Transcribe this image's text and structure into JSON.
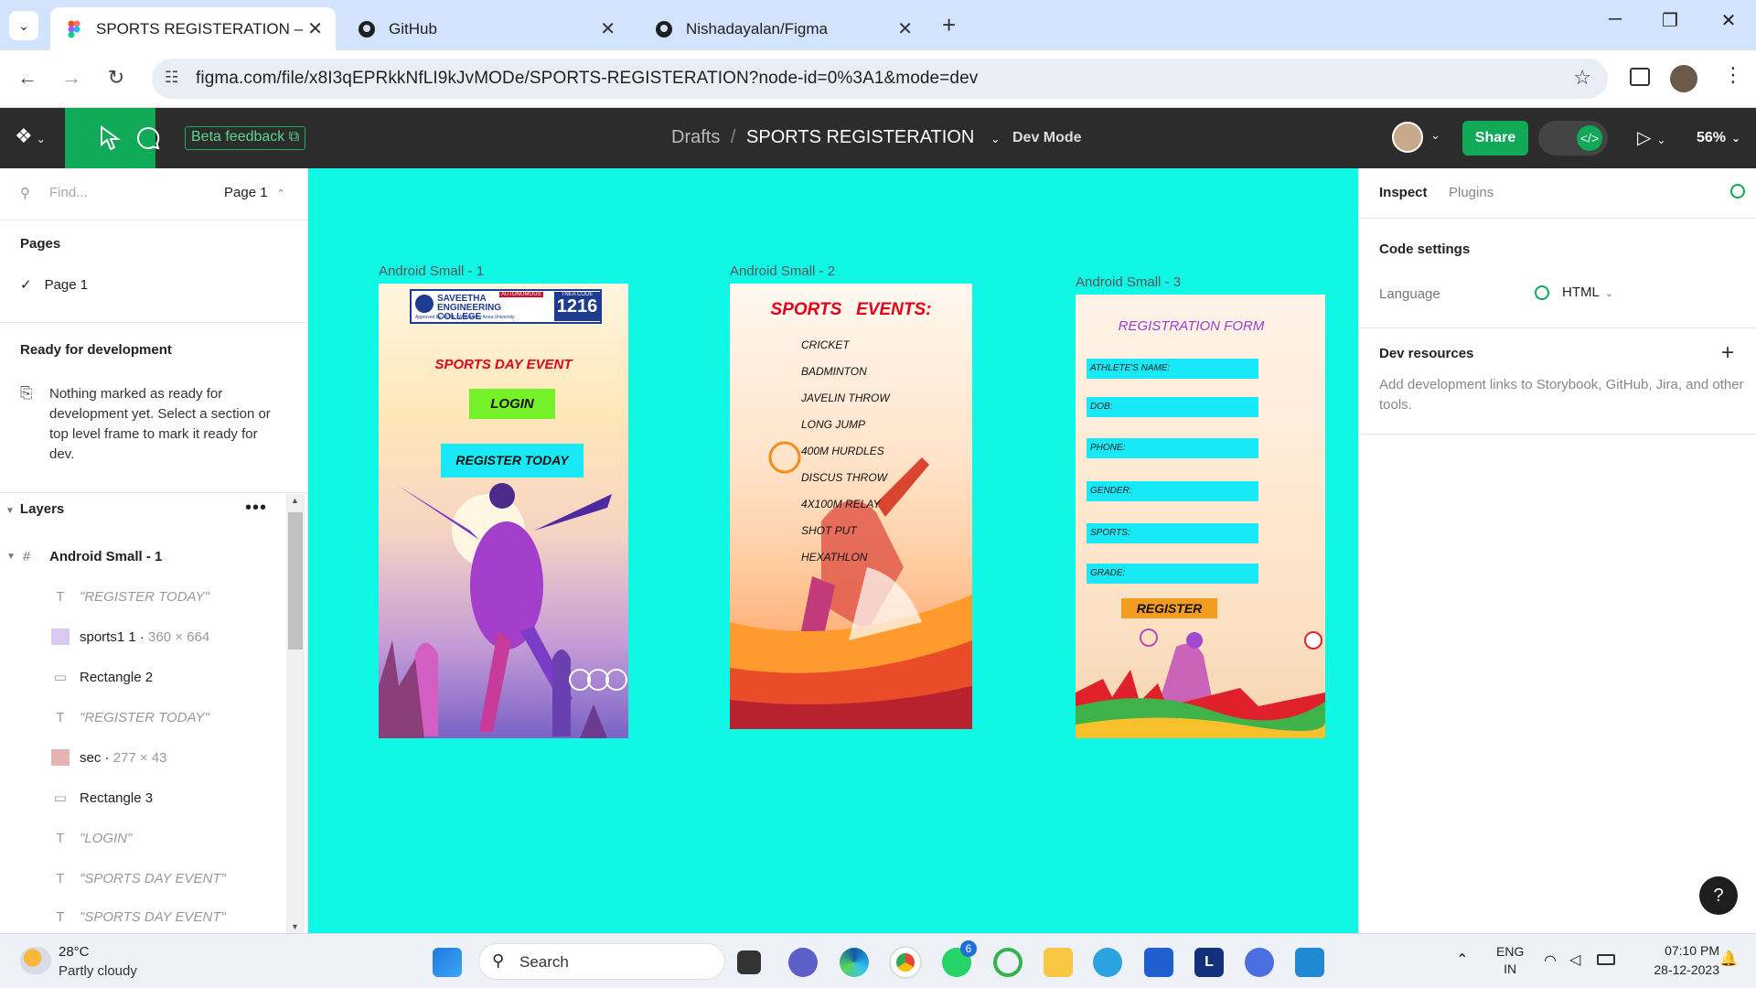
{
  "browser": {
    "tabs": [
      {
        "title": "SPORTS REGISTERATION – Figma"
      },
      {
        "title": "GitHub"
      },
      {
        "title": "Nishadayalan/Figma"
      }
    ],
    "url": "figma.com/file/x8I3qEPRkkNfLI9kJvMODe/SPORTS-REGISTERATION?node-id=0%3A1&mode=dev"
  },
  "toolbar": {
    "beta_label": "Beta feedback",
    "crumb_parent": "Drafts",
    "crumb_sep": "/",
    "file_name": "SPORTS REGISTERATION",
    "mode": "Dev Mode",
    "share": "Share",
    "zoom": "56%"
  },
  "left": {
    "find_placeholder": "Find...",
    "page_select": "Page 1",
    "pages_title": "Pages",
    "pages": [
      "Page 1"
    ],
    "ready_title": "Ready for development",
    "ready_text": "Nothing marked as ready for development yet. Select a section or top level frame to mark it ready for dev.",
    "layers_title": "Layers",
    "frame_name": "Android Small - 1",
    "layers": [
      {
        "name": "\"REGISTER TODAY\"",
        "type": "text",
        "italic": true
      },
      {
        "name": "sports1 1",
        "meta": "360 × 664",
        "type": "image"
      },
      {
        "name": "Rectangle 2",
        "type": "rect"
      },
      {
        "name": "\"REGISTER TODAY\"",
        "type": "text",
        "italic": true
      },
      {
        "name": "sec",
        "meta": "277 × 43",
        "type": "image"
      },
      {
        "name": "Rectangle 3",
        "type": "rect"
      },
      {
        "name": "\"LOGIN\"",
        "type": "text",
        "italic": true
      },
      {
        "name": "\"SPORTS DAY EVENT\"",
        "type": "text",
        "italic": true
      },
      {
        "name": "\"SPORTS DAY EVENT\"",
        "type": "text",
        "italic": true
      }
    ]
  },
  "canvas": {
    "frame1": {
      "label": "Android Small - 1",
      "college_name": "SAVEETHA ENGINEERING COLLEGE",
      "autonomous": "AUTONOMOUS",
      "approved": "Approved by AICTE | Affiliated to Anna University",
      "tnea_label": "TNEA CODE",
      "tnea_code": "1216",
      "title": "SPORTS DAY EVENT",
      "login": "LOGIN",
      "register": "REGISTER TODAY"
    },
    "frame2": {
      "label": "Android Small - 2",
      "title": "SPORTS   EVENTS:",
      "events": [
        "CRICKET",
        "BADMINTON",
        "JAVELIN THROW",
        "LONG JUMP",
        "400M HURDLES",
        "DISCUS THROW",
        "4X100M RELAY",
        "SHOT PUT",
        "HEXATHLON"
      ]
    },
    "frame3": {
      "label": "Android Small - 3",
      "title": "REGISTRATION FORM",
      "fields": [
        "ATHLETE'S NAME:",
        "DOB:",
        "PHONE:",
        "GENDER:",
        "SPORTS:",
        "GRADE:"
      ],
      "button": "REGISTER"
    }
  },
  "right": {
    "tabs": [
      "Inspect",
      "Plugins"
    ],
    "code_settings": "Code settings",
    "language_label": "Language",
    "language_value": "HTML",
    "dev_resources": "Dev resources",
    "dev_resources_text": "Add development links to Storybook, GitHub, Jira, and other tools.",
    "help": "?"
  },
  "taskbar": {
    "temp": "28°C",
    "weather": "Partly cloudy",
    "search": "Search",
    "whatsapp_badge": "6",
    "lang_line1": "ENG",
    "lang_line2": "IN",
    "time": "07:10 PM",
    "date": "28-12-2023"
  },
  "colors": {
    "canvas": "#11f7e6",
    "figma_green": "#0fa958",
    "form_field": "#19e8f7",
    "login_button": "#76f22b"
  }
}
